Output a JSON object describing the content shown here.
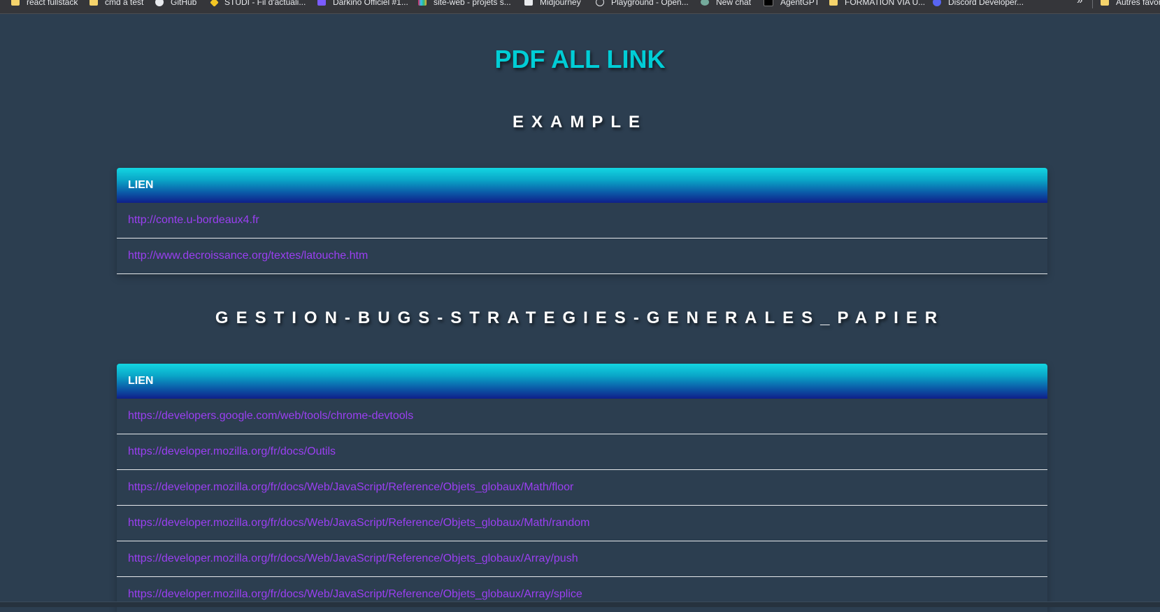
{
  "bookmarks": [
    {
      "label": "react fullstack",
      "icon": "folder-icon"
    },
    {
      "label": "cmd a test",
      "icon": "folder-icon"
    },
    {
      "label": "GitHub",
      "icon": "github-icon"
    },
    {
      "label": "STUDI - Fil d'actuali...",
      "icon": "studi-icon"
    },
    {
      "label": "Darkino Officiel #1...",
      "icon": "darkino-icon"
    },
    {
      "label": "site-web - projets s...",
      "icon": "slack-icon"
    },
    {
      "label": "Midjourney",
      "icon": "midjourney-icon"
    },
    {
      "label": "Playground - Open...",
      "icon": "openai-icon"
    },
    {
      "label": "New chat",
      "icon": "chatgpt-icon"
    },
    {
      "label": "AgentGPT",
      "icon": "agentgpt-icon"
    },
    {
      "label": "FORMATION VIA U...",
      "icon": "folder-icon"
    },
    {
      "label": "Discord Developer...",
      "icon": "discord-icon"
    }
  ],
  "bookmarks_more": "»",
  "other_bookmarks": "Autres favoris",
  "page": {
    "title": "PDF ALL LINK",
    "sections": [
      {
        "heading": "EXAMPLE",
        "column_header": "LIEN",
        "links": [
          "http://conte.u-bordeaux4.fr",
          "http://www.decroissance.org/textes/latouche.htm"
        ]
      },
      {
        "heading": "GESTION-BUGS-STRATEGIES-GENERALES_PAPIER",
        "column_header": "LIEN",
        "links": [
          "https://developers.google.com/web/tools/chrome-devtools",
          "https://developer.mozilla.org/fr/docs/Outils",
          "https://developer.mozilla.org/fr/docs/Web/JavaScript/Reference/Objets_globaux/Math/floor",
          "https://developer.mozilla.org/fr/docs/Web/JavaScript/Reference/Objets_globaux/Math/random",
          "https://developer.mozilla.org/fr/docs/Web/JavaScript/Reference/Objets_globaux/Array/push",
          "https://developer.mozilla.org/fr/docs/Web/JavaScript/Reference/Objets_globaux/Array/splice"
        ]
      }
    ]
  },
  "colors": {
    "background": "#2c3e50",
    "title": "#00cdd6",
    "link": "#9b3ff2",
    "header_gradient_top": "#13d6e2",
    "header_gradient_bottom": "#0f1f8a"
  }
}
